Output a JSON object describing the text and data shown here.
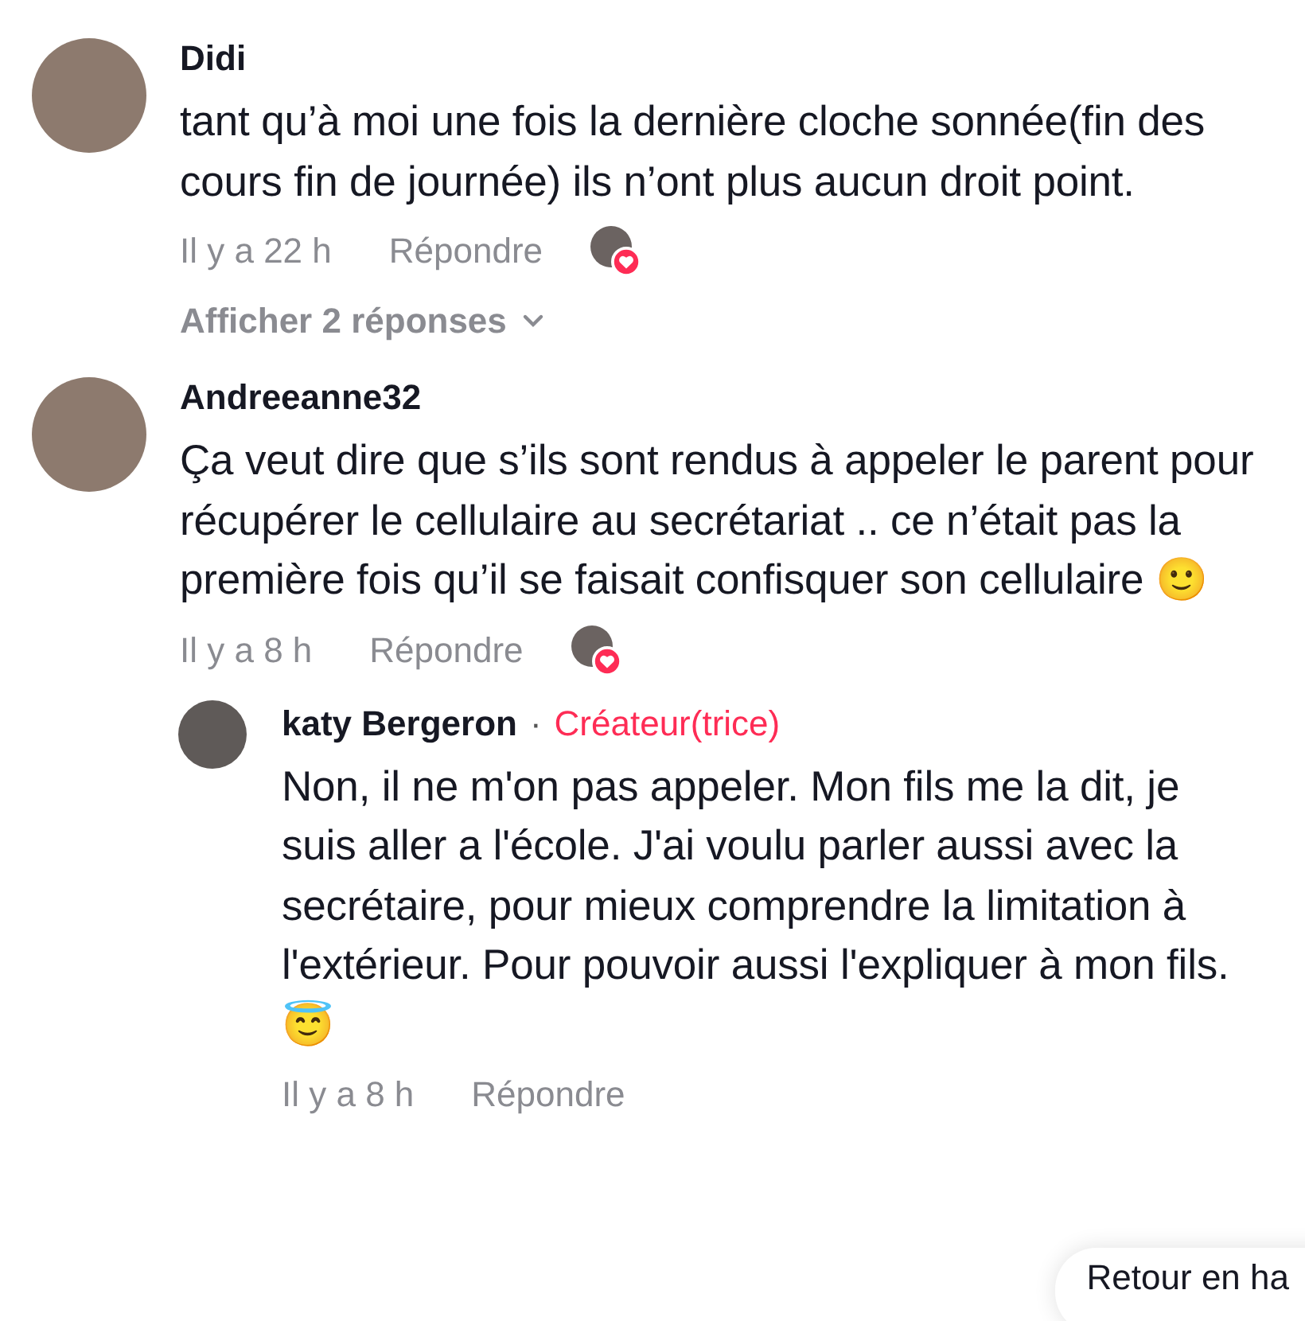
{
  "comments": [
    {
      "author": "Didi",
      "text": "tant qu’à moi une fois la dernière cloche sonnée(fin des cours fin de journée) ils n’ont plus aucun droit point.",
      "time": "Il y a 22 h",
      "reply_label": "Répondre",
      "creator_liked": true,
      "view_replies": "Afficher 2 réponses"
    },
    {
      "author": "Andreeanne32",
      "text": "Ça veut dire que s’ils sont rendus à appeler le parent pour récupérer le cellulaire au secrétariat .. ce n’était pas la première fois qu’il se faisait confisquer son cellulaire 🙂",
      "time": "Il y a 8 h",
      "reply_label": "Répondre",
      "creator_liked": true,
      "replies": [
        {
          "author": "katy Bergeron",
          "separator": "·",
          "badge": "Créateur(trice)",
          "text": "Non, il ne m'on pas appeler. Mon fils me la dit, je suis aller a l'école. J'ai voulu parler aussi avec la secrétaire, pour mieux comprendre la limitation à l'extérieur. Pour pouvoir aussi l'expliquer à mon fils.😇",
          "time": "Il y a 8 h",
          "reply_label": "Répondre"
        }
      ]
    }
  ],
  "back_to_top": "Retour en ha"
}
